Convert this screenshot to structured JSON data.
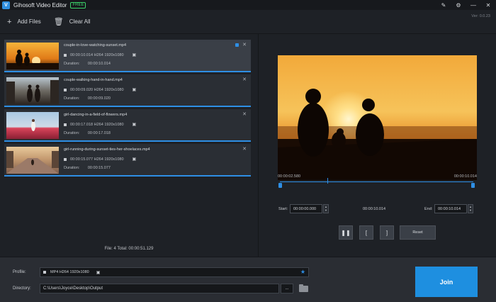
{
  "app": {
    "title": "Gihosoft Video Editor",
    "badge": "FREE",
    "logo_letter": "V",
    "version": "Ver: 0.0.23"
  },
  "window_controls": [
    {
      "name": "feedback-icon",
      "glyph": "✎"
    },
    {
      "name": "settings-icon",
      "glyph": "⚙"
    },
    {
      "name": "minimize-icon",
      "glyph": "—"
    },
    {
      "name": "close-window-icon",
      "glyph": "✕"
    }
  ],
  "toolbar": {
    "add_files": {
      "label": "Add Files",
      "icon": "+"
    },
    "clear_all": {
      "label": "Clear All",
      "icon": "🗑"
    }
  },
  "files": [
    {
      "name": "couple-in-love-watching-sunset.mp4",
      "meta": "00:00:10.014  H264  1920x1080",
      "duration_label": "Duration:",
      "duration": "00:00:10.014",
      "selected": true
    },
    {
      "name": "couple-walking-hand-in-hand.mp4",
      "meta": "00:00:09.020  H264  1920x1080",
      "duration_label": "Duration:",
      "duration": "00:00:09.020",
      "selected": false
    },
    {
      "name": "girl-dancing-in-a-field-of-flowers.mp4",
      "meta": "00:00:17.018  H264  1920x1080",
      "duration_label": "Duration:",
      "duration": "00:00:17.018",
      "selected": false
    },
    {
      "name": "girl-running-during-sunset-ties-her-shoelaces.mp4",
      "meta": "00:00:15.077  H264  1920x1080",
      "duration_label": "Duration:",
      "duration": "00:00:15.077",
      "selected": false
    }
  ],
  "summary": "File: 4   Total: 00:00:51.129",
  "player": {
    "current_time": "00:00:02.580",
    "end_time_label": "00:00:10.014",
    "playhead_fraction": 0.245,
    "start_label": "Start:",
    "start_value": "00:00:00.000",
    "middle_time": "00:00:10.014",
    "end_label": "End:",
    "end_value": "00:00:10.014",
    "pause_glyph": "❚❚",
    "mark_in_glyph": "[",
    "mark_out_glyph": "]",
    "reset_label": "Reset"
  },
  "bottom": {
    "profile_label": "Profile:",
    "profile_value": "MP4  H264  1920x1080",
    "directory_label": "Directory:",
    "directory_value": "C:\\Users\\Joyce\\Desktop\\Output",
    "browse_label": "...",
    "join_label": "Join"
  },
  "colors": {
    "accent": "#2e8fe5",
    "join": "#1e8fe0",
    "badge": "#3bd36a"
  }
}
